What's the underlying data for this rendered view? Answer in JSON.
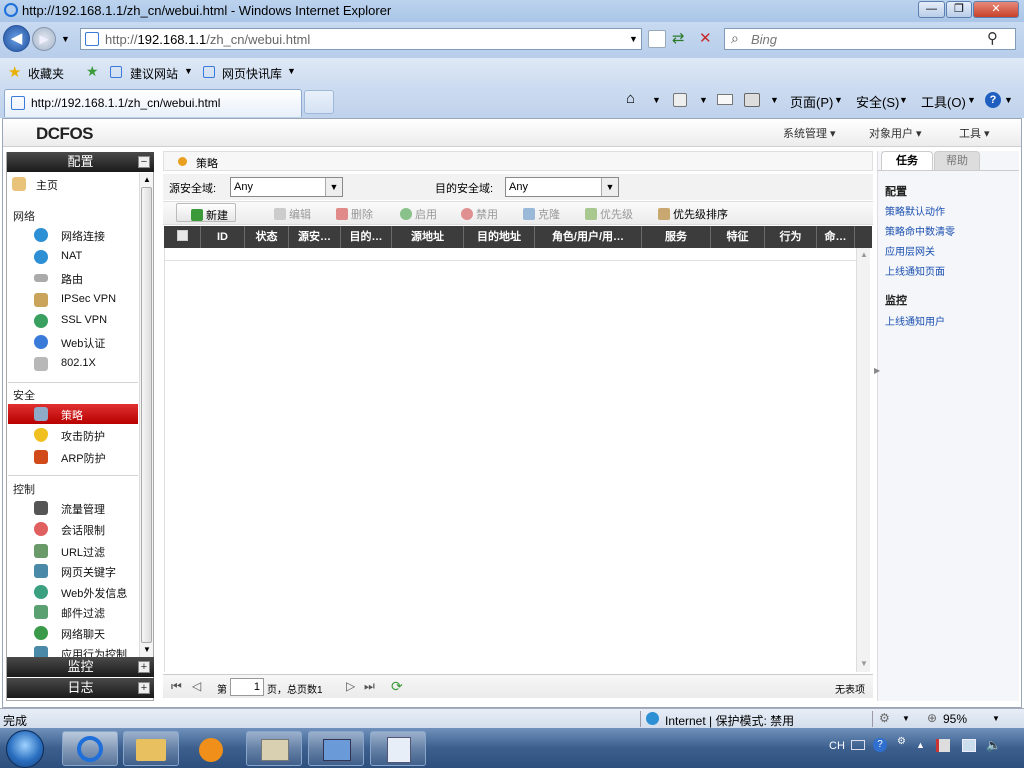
{
  "window": {
    "title": "http://192.168.1.1/zh_cn/webui.html - Windows Internet Explorer"
  },
  "address": {
    "url_prefix": "http://",
    "url_host": "192.168.1.1",
    "url_path": "/zh_cn/webui.html",
    "search_placeholder": "Bing"
  },
  "favorites": {
    "label": "收藏夹",
    "items": [
      "建议网站",
      "网页快讯库"
    ]
  },
  "tab": {
    "title": "http://192.168.1.1/zh_cn/webui.html"
  },
  "commandbar": {
    "page": "页面(P)",
    "safety": "安全(S)",
    "tools": "工具(O)"
  },
  "app": {
    "logo": "DCFOS",
    "menus": [
      "系统管理",
      "对象用户",
      "工具"
    ]
  },
  "leftnav": {
    "config_header": "配置",
    "home": "主页",
    "sections": [
      {
        "title": "网络",
        "items": [
          "网络连接",
          "NAT",
          "路由",
          "IPSec VPN",
          "SSL VPN",
          "Web认证",
          "802.1X"
        ]
      },
      {
        "title": "安全",
        "items": [
          "策略",
          "攻击防护",
          "ARP防护"
        ]
      },
      {
        "title": "控制",
        "items": [
          "流量管理",
          "会话限制",
          "URL过滤",
          "网页关键字",
          "Web外发信息",
          "邮件过滤",
          "网络聊天",
          "应用行为控制"
        ]
      }
    ],
    "monitor_header": "监控",
    "log_header": "日志"
  },
  "breadcrumb": {
    "label": "策略"
  },
  "filter": {
    "src_label": "源安全域:",
    "src_value": "Any",
    "dst_label": "目的安全域:",
    "dst_value": "Any"
  },
  "toolbar": {
    "new": "新建",
    "edit": "编辑",
    "delete": "删除",
    "enable": "启用",
    "disable": "禁用",
    "clone": "克隆",
    "priority": "优先级",
    "priority_sort": "优先级排序"
  },
  "table": {
    "columns": [
      "ID",
      "状态",
      "源安…",
      "目的…",
      "源地址",
      "目的地址",
      "角色/用户/用…",
      "服务",
      "特征",
      "行为",
      "命…"
    ]
  },
  "pager": {
    "page_prefix": "第",
    "page_value": "1",
    "page_suffix": "页，总页数1",
    "empty": "无表项"
  },
  "rightpanel": {
    "tabs": [
      "任务",
      "帮助"
    ],
    "config_title": "配置",
    "config_links": [
      "策略默认动作",
      "策略命中数清零",
      "应用层网关",
      "上线通知页面"
    ],
    "monitor_title": "监控",
    "monitor_links": [
      "上线通知用户"
    ]
  },
  "statusbar": {
    "left": "完成",
    "zone": "Internet | 保护模式: 禁用",
    "zoom": "95%"
  },
  "tray": {
    "lang": "CH"
  },
  "colors": {
    "selected_nav": "#c00000",
    "header_dark": "#3c3c3c",
    "link": "#1a4fb0"
  }
}
